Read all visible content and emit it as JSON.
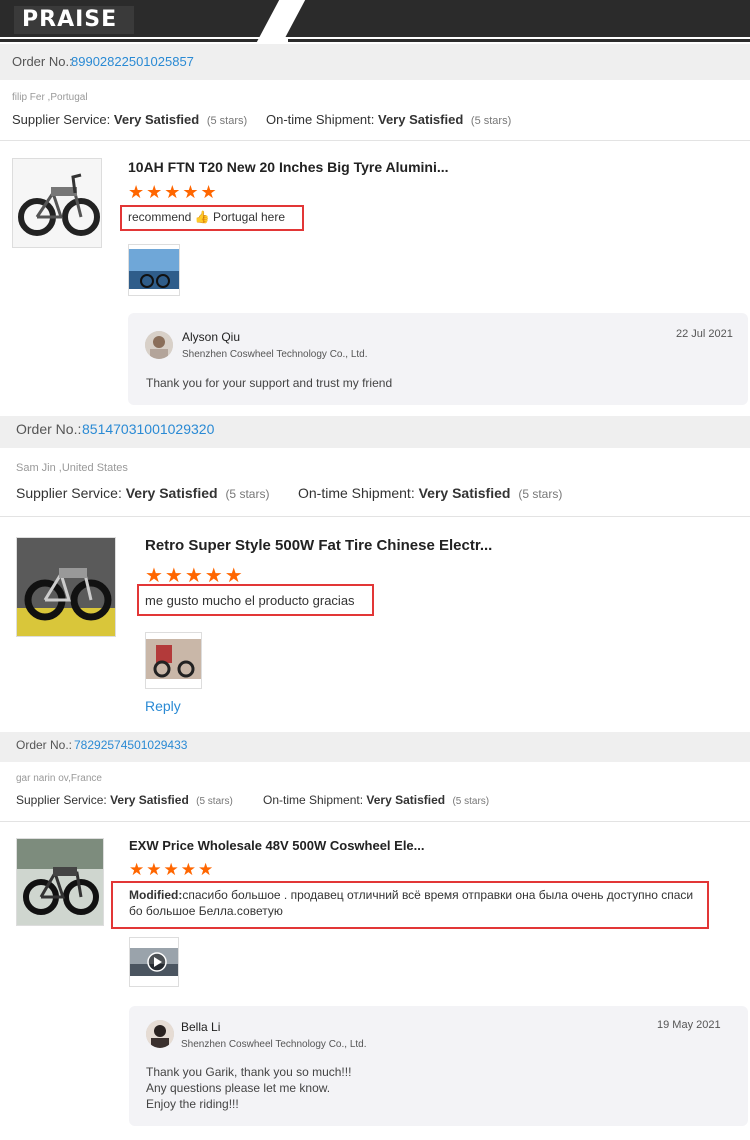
{
  "header": {
    "title": "PRAISE"
  },
  "orders": [
    {
      "order_label": "Order No.:",
      "order_number": "89902822501025857",
      "buyer": "filip  Fer      ,Portugal",
      "supplier_label": "Supplier Service:",
      "supplier_value": "Very Satisfied",
      "supplier_stars": "(5 stars)",
      "shipment_label": "On-time Shipment:",
      "shipment_value": "Very Satisfied",
      "shipment_stars": "(5 stars)",
      "product_title": "10AH FTN T20 New 20 Inches Big Tyre Alumini...",
      "stars": "★★★★★",
      "review": "recommend 👍 Portugal here",
      "reply": {
        "name": "Alyson Qiu",
        "company": "Shenzhen Coswheel Technology Co., Ltd.",
        "date": "22 Jul 2021",
        "message": "Thank you for your support and trust my friend"
      }
    },
    {
      "order_label": "Order No.:",
      "order_number": "85147031001029320",
      "buyer": "Sam     Jin     ,United States",
      "supplier_label": "Supplier Service:",
      "supplier_value": "Very Satisfied",
      "supplier_stars": "(5 stars)",
      "shipment_label": "On-time Shipment:",
      "shipment_value": "Very Satisfied",
      "shipment_stars": "(5 stars)",
      "product_title": "Retro Super Style 500W Fat Tire Chinese Electr...",
      "stars": "★★★★★",
      "review": "me gusto mucho el producto gracias",
      "reply_link": "Reply"
    },
    {
      "order_label": "Order No.:",
      "order_number": "78292574501029433",
      "buyer": "gar  narin   ov,France",
      "supplier_label": "Supplier Service:",
      "supplier_value": "Very Satisfied",
      "supplier_stars": "(5 stars)",
      "shipment_label": "On-time Shipment:",
      "shipment_value": "Very Satisfied",
      "shipment_stars": "(5 stars)",
      "product_title": "EXW Price Wholesale 48V 500W Coswheel Ele...",
      "stars": "★★★★★",
      "review_prefix": "Modified:",
      "review": "спасибо большое . продавец отличний всё время отправки она была очень доступно спаси бо большое Белла.советую",
      "reply": {
        "name": "Bella Li",
        "company": "Shenzhen Coswheel Technology Co., Ltd.",
        "date": "19 May 2021",
        "message_lines": [
          "Thank you Garik, thank you so much!!!",
          "Any questions please let me know.",
          "Enjoy the riding!!!"
        ]
      }
    }
  ],
  "colors": {
    "accent": "#2a8ad4",
    "stars": "#ff6600",
    "highlight": "#e23636",
    "header": "#2b2b2b"
  }
}
